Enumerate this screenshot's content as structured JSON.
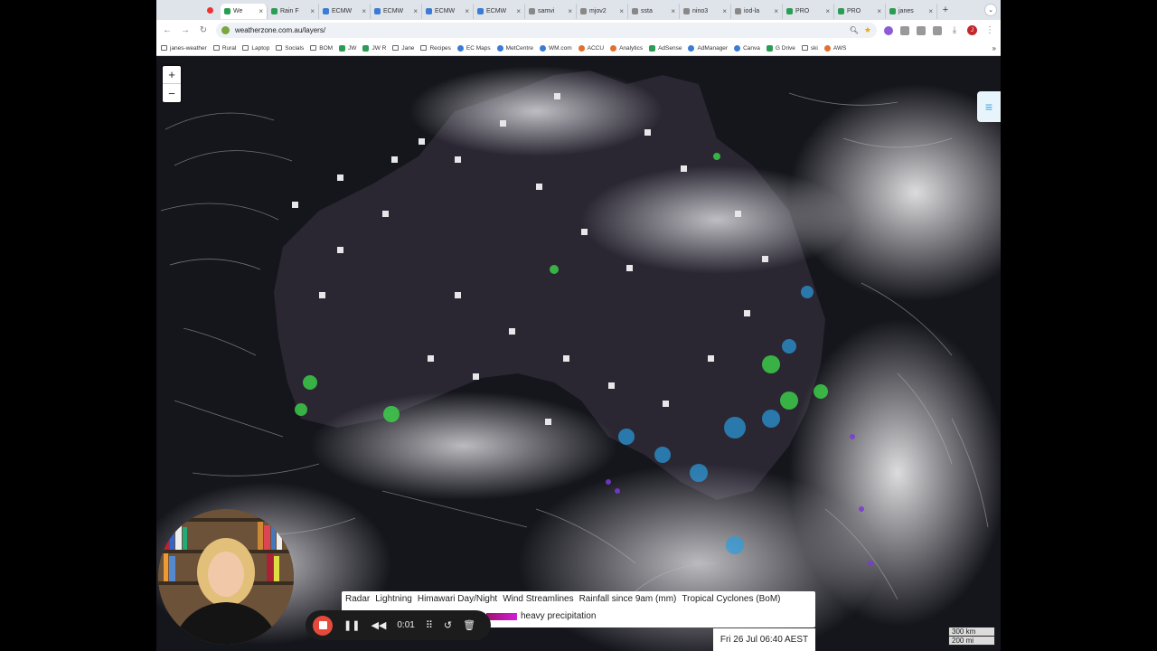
{
  "tabs": [
    {
      "label": "We",
      "active": true
    },
    {
      "label": "Rain F"
    },
    {
      "label": "ECMW"
    },
    {
      "label": "ECMW"
    },
    {
      "label": "ECMW"
    },
    {
      "label": "ECMW"
    },
    {
      "label": "samvi"
    },
    {
      "label": "mjov2"
    },
    {
      "label": "ssta"
    },
    {
      "label": "nino3"
    },
    {
      "label": "iod-la"
    },
    {
      "label": "PRO"
    },
    {
      "label": "PRO"
    },
    {
      "label": "janes"
    }
  ],
  "address_bar": {
    "url": "weatherzone.com.au/layers/"
  },
  "bookmarks": [
    "janes-weather",
    "Rural",
    "Laptop",
    "Socials",
    "BOM",
    "JW",
    "JW R",
    "Jane",
    "Recipes",
    "EC Maps",
    "MetCentre",
    "WM.com",
    "ACCU",
    "Analytics",
    "AdSense",
    "AdManager",
    "Canva",
    "G Drive",
    "ski",
    "AWS"
  ],
  "map": {
    "zoom_in": "+",
    "zoom_out": "−",
    "layers": [
      "Radar",
      "Lightning",
      "Himawari Day/Night",
      "Wind Streamlines",
      "Rainfall since 9am (mm)",
      "Tropical Cyclones (BoM)"
    ],
    "legend_label": "heavy precipitation",
    "timestamp": "Fri 26 Jul 06:40 AEST",
    "scale_km": "300 km",
    "scale_mi": "200 mi"
  },
  "recorder": {
    "time": "0:01"
  },
  "colors": {
    "radar_light": "#2b9de0",
    "radar_green": "#3dd64a",
    "lightning": "#7a3ad6",
    "map_bg": "#15151c"
  }
}
